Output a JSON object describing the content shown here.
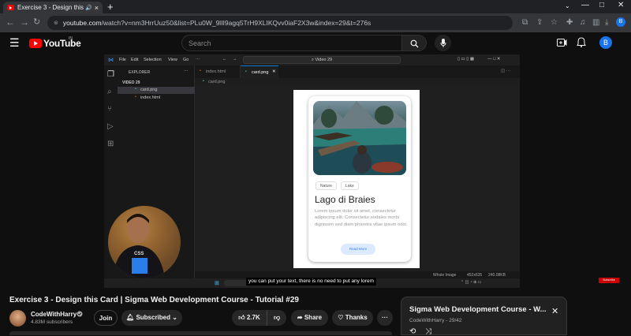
{
  "browser": {
    "tab_title": "Exercise 3 - Design this Card",
    "tab_close": "×",
    "new_tab": "+",
    "url_host": "youtube.com",
    "url_path": "/watch?v=nm3HrrUuz50&list=PLu0W_9lII9agq5TrH9XLIKQvv0iaF2X3w&index=29&t=276s",
    "profile_initial": "B",
    "win_min": "—",
    "win_max": "□",
    "win_close": "✕"
  },
  "youtube": {
    "logo_text": "YouTube",
    "country_code": "IN",
    "search_placeholder": "Search",
    "avatar_initial": "B"
  },
  "vscode": {
    "menu": [
      "File",
      "Edit",
      "Selection",
      "View",
      "Go"
    ],
    "search_text": "Video 29",
    "explorer_label": "EXPLORER",
    "folder": "VIDEO 29",
    "files": [
      "card.png",
      "index.html"
    ],
    "tabs": [
      "index.html",
      "card.png"
    ],
    "breadcrumb": "card.png",
    "status_image": "Whole Image",
    "status_dims": "452x635",
    "status_size": "240.08KB"
  },
  "card": {
    "chips": [
      "Nature",
      "Lake"
    ],
    "title": "Lago di Braies",
    "body": "Lorem ipsum dolor sit amet, consectetur adipiscing elit. Consectetur sodales morbi dignissim sed diam pharetra vitae ipsum odio.",
    "button": "Read More"
  },
  "caption": "you can put your text, there is no need to put any lorem",
  "subscribe_badge": "Subscribe",
  "video": {
    "title": "Exercise 3 - Design this Card | Sigma Web Development Course - Tutorial #29",
    "channel": "CodeWithHarry",
    "subscribers": "4.83M subscribers",
    "join": "Join",
    "subscribed": "Subscribed",
    "likes": "2.7K",
    "share": "Share",
    "thanks": "Thanks",
    "more": "···"
  },
  "playlist": {
    "title": "Sigma Web Development Course - W...",
    "channel": "CodeWithHarry",
    "position": "29/42"
  }
}
